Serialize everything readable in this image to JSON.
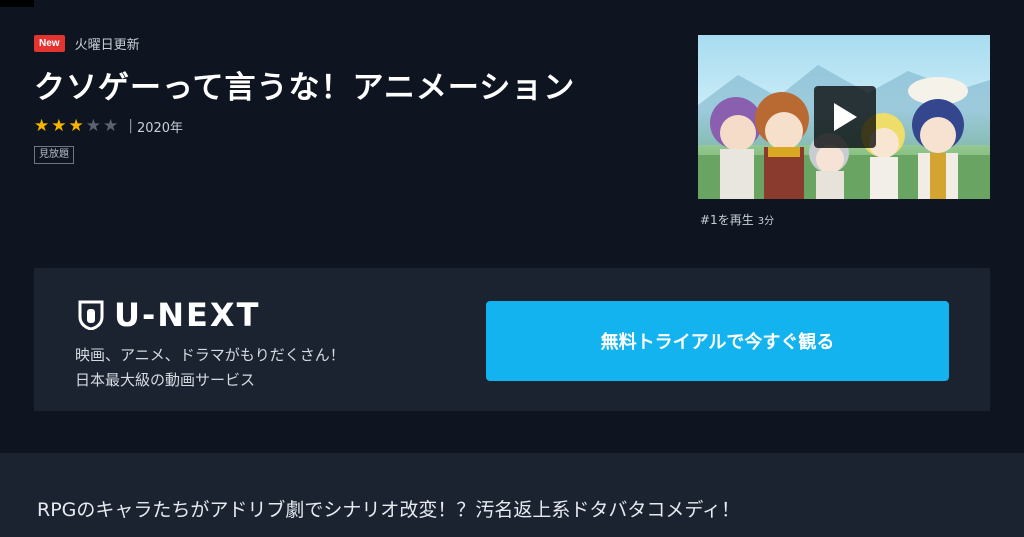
{
  "badge": {
    "new": "New"
  },
  "schedule": "火曜日更新",
  "title": "クソゲーって言うな！アニメーション",
  "rating": {
    "value": 3,
    "max": 5
  },
  "year": "2020年",
  "tag": "見放題",
  "episode": {
    "label": "#1を再生",
    "duration": "3分"
  },
  "promo": {
    "brand": "U-NEXT",
    "line1": "映画、アニメ、ドラマがもりだくさん！",
    "line2": "日本最大級の動画サービス",
    "cta": "無料トライアルで今すぐ観る"
  },
  "synopsis": "RPGのキャラたちがアドリブ劇でシナリオ改変！？汚名返上系ドタバタコメディ！",
  "colors": {
    "accent": "#12b3ee",
    "star": "#f7b500",
    "new_badge": "#e3342f"
  }
}
